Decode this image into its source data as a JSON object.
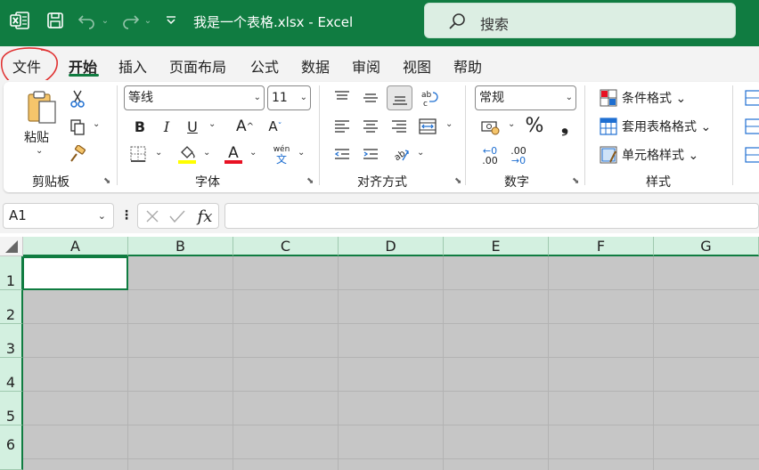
{
  "titlebar": {
    "title": "我是一个表格.xlsx  -  Excel",
    "search_placeholder": "搜索",
    "icons": [
      "excel-logo-icon",
      "save-icon",
      "undo-icon",
      "redo-icon",
      "customize-toolbar-icon",
      "search-icon"
    ]
  },
  "tabs": [
    {
      "label": "文件"
    },
    {
      "label": "开始",
      "active": true
    },
    {
      "label": "插入"
    },
    {
      "label": "页面布局"
    },
    {
      "label": "公式"
    },
    {
      "label": "数据"
    },
    {
      "label": "审阅"
    },
    {
      "label": "视图"
    },
    {
      "label": "帮助"
    }
  ],
  "ribbon": {
    "clipboard": {
      "label": "剪贴板",
      "paste_label": "粘贴"
    },
    "font": {
      "label": "字体",
      "font_name": "等线",
      "font_size": "11",
      "phonetic_top": "wén",
      "phonetic_bottom": "文",
      "highlight_color": "#ffff00",
      "font_color": "#e81123"
    },
    "alignment": {
      "label": "对齐方式"
    },
    "number": {
      "label": "数字",
      "format": "常规",
      "percent": "%",
      "comma": "❟",
      "inc_decimal_top": "←0",
      "inc_decimal_bottom": ".00",
      "dec_decimal_top": ".00",
      "dec_decimal_bottom": "→0"
    },
    "styles": {
      "label": "样式",
      "conditional": "条件格式",
      "table_format": "套用表格格式",
      "cell_styles": "单元格样式"
    }
  },
  "formula_bar": {
    "name_box": "A1",
    "fx": "fx",
    "value": ""
  },
  "grid": {
    "columns": [
      "A",
      "B",
      "C",
      "D",
      "E",
      "F",
      "G"
    ],
    "rows": [
      "1",
      "2",
      "3",
      "4",
      "5",
      "6"
    ],
    "active_cell": "A1"
  },
  "colors": {
    "brand": "#107c41",
    "header_bg": "#d3f0e0",
    "grid_fill": "#c6c6c6",
    "annotation": "#e03030"
  }
}
